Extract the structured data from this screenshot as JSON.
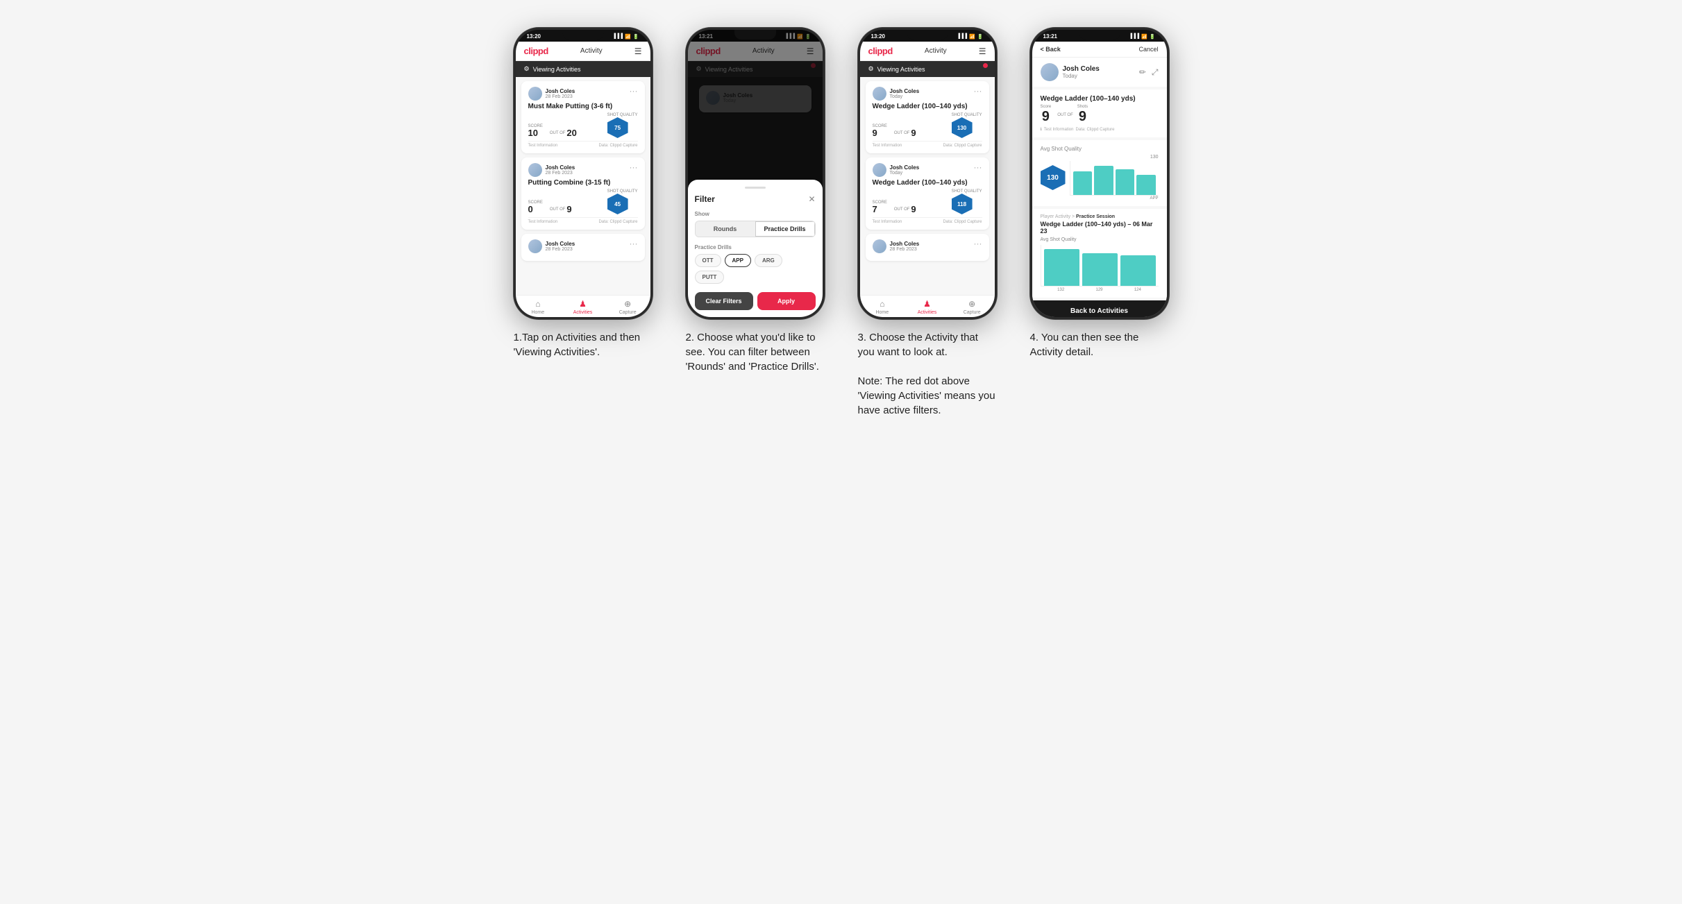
{
  "phones": [
    {
      "id": "phone1",
      "status_time": "13:20",
      "header": {
        "logo": "clippd",
        "title": "Activity",
        "menu_icon": "☰"
      },
      "viewing_bar": {
        "label": "Viewing Activities",
        "has_red_dot": false
      },
      "cards": [
        {
          "user_name": "Josh Coles",
          "user_date": "28 Feb 2023",
          "title": "Must Make Putting (3-6 ft)",
          "score_label": "Score",
          "score_val": "10",
          "shots_label": "Shots",
          "outof": "OUT OF",
          "shots_val": "20",
          "quality_label": "Shot Quality",
          "quality_val": "75",
          "footer_left": "Test Information",
          "footer_right": "Data: Clippd Capture"
        },
        {
          "user_name": "Josh Coles",
          "user_date": "28 Feb 2023",
          "title": "Putting Combine (3-15 ft)",
          "score_label": "Score",
          "score_val": "0",
          "shots_label": "Shots",
          "outof": "OUT OF",
          "shots_val": "9",
          "quality_label": "Shot Quality",
          "quality_val": "45",
          "footer_left": "Test Information",
          "footer_right": "Data: Clippd Capture"
        },
        {
          "user_name": "Josh Coles",
          "user_date": "28 Feb 2023",
          "title": "",
          "score_label": "",
          "score_val": "",
          "shots_val": "",
          "quality_val": "",
          "footer_left": "",
          "footer_right": ""
        }
      ],
      "nav": [
        {
          "label": "Home",
          "icon": "⌂",
          "active": false
        },
        {
          "label": "Activities",
          "icon": "♟",
          "active": true
        },
        {
          "label": "Capture",
          "icon": "⊕",
          "active": false
        }
      ]
    },
    {
      "id": "phone2",
      "status_time": "13:21",
      "header": {
        "logo": "clippd",
        "title": "Activity",
        "menu_icon": "☰"
      },
      "viewing_bar": {
        "label": "Viewing Activities",
        "has_red_dot": true
      },
      "filter": {
        "title": "Filter",
        "close_icon": "✕",
        "show_label": "Show",
        "toggle_options": [
          "Rounds",
          "Practice Drills"
        ],
        "active_toggle": "Practice Drills",
        "practice_drills_label": "Practice Drills",
        "pills": [
          "OTT",
          "APP",
          "ARG",
          "PUTT"
        ],
        "active_pills": [
          "APP"
        ],
        "clear_label": "Clear Filters",
        "apply_label": "Apply"
      }
    },
    {
      "id": "phone3",
      "status_time": "13:20",
      "header": {
        "logo": "clippd",
        "title": "Activity",
        "menu_icon": "☰"
      },
      "viewing_bar": {
        "label": "Viewing Activities",
        "has_red_dot": true
      },
      "cards": [
        {
          "user_name": "Josh Coles",
          "user_date": "Today",
          "title": "Wedge Ladder (100–140 yds)",
          "score_label": "Score",
          "score_val": "9",
          "shots_label": "Shots",
          "outof": "OUT OF",
          "shots_val": "9",
          "quality_label": "Shot Quality",
          "quality_val": "130",
          "footer_left": "Test Information",
          "footer_right": "Data: Clippd Capture"
        },
        {
          "user_name": "Josh Coles",
          "user_date": "Today",
          "title": "Wedge Ladder (100–140 yds)",
          "score_label": "Score",
          "score_val": "7",
          "shots_label": "Shots",
          "outof": "OUT OF",
          "shots_val": "9",
          "quality_label": "Shot Quality",
          "quality_val": "118",
          "footer_left": "Test Information",
          "footer_right": "Data: Clippd Capture"
        },
        {
          "user_name": "Josh Coles",
          "user_date": "28 Feb 2023",
          "title": "",
          "score_val": "",
          "shots_val": "",
          "quality_val": ""
        }
      ],
      "nav": [
        {
          "label": "Home",
          "icon": "⌂",
          "active": false
        },
        {
          "label": "Activities",
          "icon": "♟",
          "active": true
        },
        {
          "label": "Capture",
          "icon": "⊕",
          "active": false
        }
      ]
    },
    {
      "id": "phone4",
      "status_time": "13:21",
      "back_label": "< Back",
      "cancel_label": "Cancel",
      "user_name": "Josh Coles",
      "user_date": "Today",
      "drill_name": "Wedge Ladder (100–140 yds)",
      "score_col_label": "Score",
      "shots_col_label": "Shots",
      "score_val": "9",
      "outof_label": "OUT OF",
      "shots_val": "9",
      "info_text1": "Test Information",
      "info_text2": "Data: Clippd Capture",
      "avg_quality_label": "Avg Shot Quality",
      "quality_val": "130",
      "chart_bars": [
        80,
        95,
        88,
        75
      ],
      "chart_labels": [
        "132",
        "129",
        "124"
      ],
      "chart_ref": "130",
      "practice_session_text": "Player Activity > Practice Session",
      "drill_detail_title": "Wedge Ladder (100–140 yds) – 06 Mar 23",
      "avg_shot_quality": "Avg Shot Quality",
      "back_to_activities": "Back to Activities"
    }
  ],
  "captions": [
    "1.Tap on Activities and then 'Viewing Activities'.",
    "2. Choose what you'd like to see. You can filter between 'Rounds' and 'Practice Drills'.",
    "3. Choose the Activity that you want to look at.\n\nNote: The red dot above 'Viewing Activities' means you have active filters.",
    "4. You can then see the Activity detail."
  ]
}
